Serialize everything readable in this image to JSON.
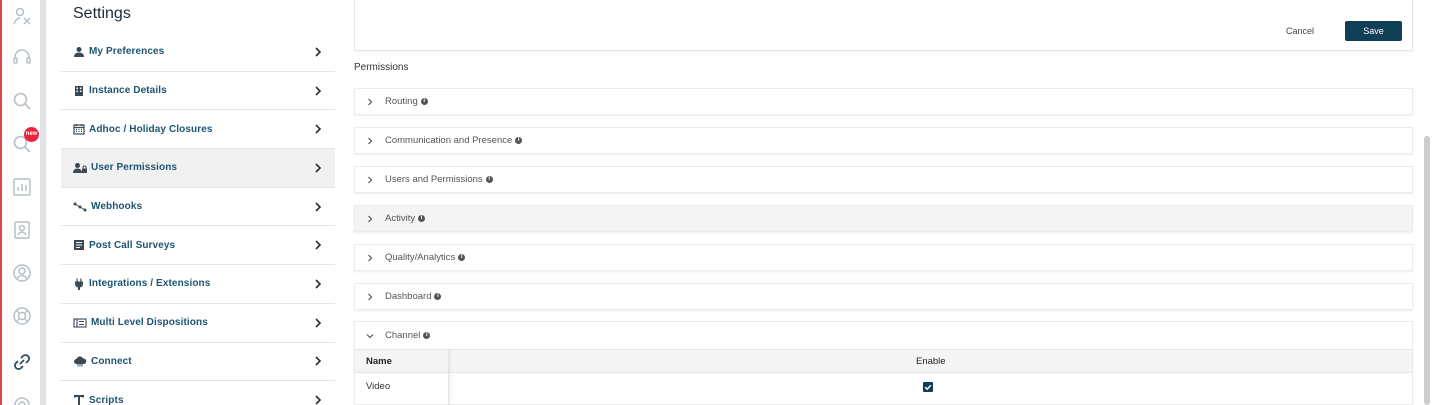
{
  "rail": {
    "badge": "new",
    "icons": [
      "agent-icon",
      "headset-icon",
      "search-icon",
      "search-new-icon",
      "reports-icon",
      "contacts-icon",
      "profile-icon",
      "support-icon",
      "link-icon",
      "settings-icon"
    ]
  },
  "settings": {
    "title": "Settings",
    "items": [
      {
        "label": "My Preferences",
        "icon": "person-icon"
      },
      {
        "label": "Instance Details",
        "icon": "building-icon"
      },
      {
        "label": "Adhoc / Holiday Closures",
        "icon": "calendar-icon"
      },
      {
        "label": "User Permissions",
        "icon": "users-lock-icon",
        "active": true
      },
      {
        "label": "Webhooks",
        "icon": "webhook-icon"
      },
      {
        "label": "Post Call Surveys",
        "icon": "survey-icon"
      },
      {
        "label": "Integrations / Extensions",
        "icon": "plug-icon"
      },
      {
        "label": "Multi Level Dispositions",
        "icon": "dispositions-icon"
      },
      {
        "label": "Connect",
        "icon": "cloud-icon"
      },
      {
        "label": "Scripts",
        "icon": "text-icon"
      }
    ]
  },
  "toolbar": {
    "cancel_label": "Cancel",
    "save_label": "Save"
  },
  "permissions": {
    "heading": "Permissions",
    "sections": [
      {
        "label": "Routing",
        "expanded": false
      },
      {
        "label": "Communication and Presence",
        "expanded": false
      },
      {
        "label": "Users and Permissions",
        "expanded": false
      },
      {
        "label": "Activity",
        "expanded": false
      },
      {
        "label": "Quality/Analytics",
        "expanded": false
      },
      {
        "label": "Dashboard",
        "expanded": false
      },
      {
        "label": "Channel",
        "expanded": true
      }
    ],
    "channel_table": {
      "col_name": "Name",
      "col_enable": "Enable",
      "rows": [
        {
          "name": "Video",
          "enabled": true
        }
      ]
    }
  },
  "colors": {
    "primary": "#0e3f57",
    "link": "#1e5471",
    "badge": "#e8243a"
  }
}
